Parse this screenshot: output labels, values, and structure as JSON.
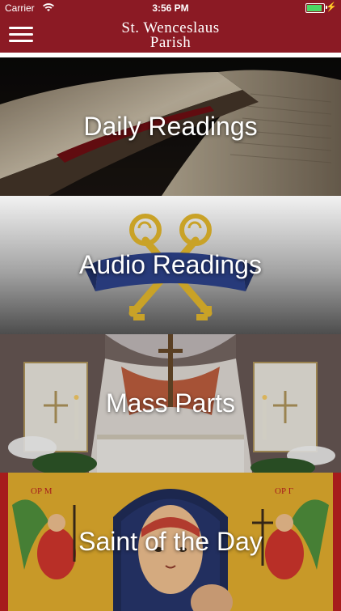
{
  "status_bar": {
    "carrier": "Carrier",
    "time": "3:56 PM",
    "battery_level": 0.9,
    "icons": [
      "wifi-icon",
      "battery-icon",
      "charging-bolt-icon"
    ]
  },
  "header": {
    "title_line1": "St. Wenceslaus",
    "title_line2": "Parish",
    "menu_icon": "hamburger-menu-icon",
    "bar_color": "#8b1a24"
  },
  "tiles": [
    {
      "label": "Daily Readings",
      "image": "open-bible"
    },
    {
      "label": "Audio Readings",
      "image": "crossed-keys-emblem"
    },
    {
      "label": "Mass Parts",
      "image": "church-altar"
    },
    {
      "label": "Saint of the Day",
      "image": "madonna-icon-painting"
    }
  ]
}
